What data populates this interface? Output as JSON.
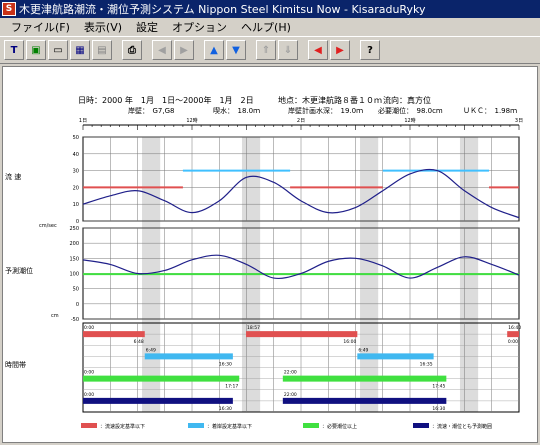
{
  "window": {
    "icon_text": "S",
    "title": "木更津航路潮流・潮位予測システム Nippon Steel Kimitsu Now - KisaraduRyky"
  },
  "menu": [
    "ファイル(F)",
    "表示(V)",
    "設定",
    "オプション",
    "ヘルプ(H)"
  ],
  "toolbar": {
    "buttons": [
      {
        "name": "t-button",
        "glyph": "T",
        "color": "#000080"
      },
      {
        "name": "window-button",
        "glyph": "▣",
        "color": "#008000"
      },
      {
        "name": "page-button",
        "glyph": "▭",
        "color": "#000"
      },
      {
        "name": "grid-button",
        "glyph": "▦",
        "color": "#000080"
      },
      {
        "name": "copy-button",
        "glyph": "▤",
        "color": "#808080"
      },
      {
        "name": "print-button",
        "glyph": "⎙",
        "color": "#000"
      },
      {
        "name": "prev-gray-button",
        "glyph": "◀",
        "color": "#a0a0a0"
      },
      {
        "name": "next-gray-button",
        "glyph": "▶",
        "color": "#a0a0a0"
      },
      {
        "name": "up-blue-button",
        "glyph": "▲",
        "color": "#1060e0"
      },
      {
        "name": "down-blue-button",
        "glyph": "▼",
        "color": "#1060e0"
      },
      {
        "name": "up-gray-button",
        "glyph": "⇑",
        "color": "#a0a0a0"
      },
      {
        "name": "down-gray-button",
        "glyph": "⇓",
        "color": "#a0a0a0"
      },
      {
        "name": "prev-red-button",
        "glyph": "◀",
        "color": "#e02020"
      },
      {
        "name": "next-red-button",
        "glyph": "▶",
        "color": "#e02020"
      },
      {
        "name": "help-button",
        "glyph": "?",
        "color": "#000"
      }
    ]
  },
  "header": {
    "line1_date": "日時：2000 年　1月　1日～2000年　1月　2日",
    "line1_place": "地点：木更津航路８番１０ｍ",
    "line1_dir": "流向：真方位",
    "line2_pier": "岸壁：　G7,G8",
    "line2_draft": "喫水：　18.0ｍ",
    "line2_depth": "岸壁計画水深：　19.0ｍ",
    "line2_req": "必要潮位：　98.0cm",
    "line2_ukc": "ＵＫＣ：　1.98ｍ"
  },
  "axis": {
    "day_labels": [
      "1日",
      "12時",
      "2日",
      "12時",
      "3日"
    ],
    "flow_label": "流 速",
    "flow_unit": "cm/sec",
    "flow_ticks": [
      "50",
      "40",
      "30",
      "20",
      "10",
      "0"
    ],
    "tide_label": "予測潮位",
    "tide_unit": "cm",
    "tide_ticks": [
      "250",
      "200",
      "150",
      "100",
      "50",
      "0",
      "-50"
    ],
    "window_label": "時間帯"
  },
  "chart_data": {
    "type": "line",
    "x_range_hours": [
      0,
      48
    ],
    "series": [
      {
        "name": "流速",
        "color": "#20208a",
        "x": [
          0,
          3,
          6,
          9,
          12,
          15,
          18,
          21,
          24,
          27,
          30,
          33,
          36,
          39,
          42,
          45,
          48
        ],
        "values": [
          10,
          15,
          18,
          12,
          5,
          12,
          26,
          23,
          12,
          5,
          8,
          18,
          28,
          30,
          18,
          8,
          2
        ]
      },
      {
        "name": "潮位",
        "color": "#20208a",
        "x": [
          0,
          3,
          6,
          9,
          12,
          15,
          18,
          21,
          24,
          27,
          30,
          33,
          36,
          39,
          42,
          45,
          48
        ],
        "values": [
          145,
          130,
          100,
          110,
          145,
          160,
          130,
          85,
          100,
          140,
          150,
          125,
          85,
          120,
          155,
          130,
          95
        ]
      }
    ],
    "flow_ylim": [
      0,
      50
    ],
    "tide_ylim": [
      -50,
      250
    ],
    "flow_thresholds": [
      {
        "color": "#e05050",
        "value": 20,
        "ranges": [
          [
            0,
            11
          ],
          [
            22.8,
            33
          ],
          [
            44.7,
            48
          ]
        ]
      },
      {
        "color": "#40c0ff",
        "value": 30,
        "ranges": [
          [
            11,
            22.8
          ],
          [
            33,
            44.7
          ]
        ]
      }
    ],
    "tide_threshold": {
      "color": "#40e040",
      "value": 98
    },
    "shaded_night_hours": [
      [
        6.5,
        8.5
      ],
      [
        17.5,
        19.5
      ],
      [
        30.5,
        32.5
      ],
      [
        41.5,
        43.5
      ]
    ],
    "windows": [
      {
        "color": "#e05050",
        "bars": [
          [
            0,
            6.8
          ],
          [
            17.95,
            30.2
          ],
          [
            46.7,
            48
          ]
        ],
        "start_labels": [
          "0:00",
          "18:57",
          "16:40"
        ],
        "end_labels": [
          "6:48",
          "16:00",
          "0:00"
        ]
      },
      {
        "color": "#40b8f0",
        "bars": [
          [
            6.8,
            16.5
          ],
          [
            30.2,
            38.6
          ]
        ],
        "start_labels": [
          "6:49",
          "6:49"
        ],
        "end_labels": [
          "16:30",
          "16:35"
        ]
      },
      {
        "color": "#40e040",
        "bars": [
          [
            0,
            17.2
          ],
          [
            22,
            40
          ]
        ],
        "start_labels": [
          "0:00",
          "22:00"
        ],
        "end_labels": [
          "17:17",
          "17:45"
        ]
      },
      {
        "color": "#101080",
        "bars": [
          [
            0,
            16.5
          ],
          [
            22,
            40
          ]
        ],
        "start_labels": [
          "0:00",
          "22:00"
        ],
        "end_labels": [
          "16:30",
          "16:30"
        ]
      }
    ]
  },
  "legend": [
    {
      "color": "#e05050",
      "label": "：流速設定基準以下"
    },
    {
      "color": "#40b8f0",
      "label": "：着岸設定基準以下"
    },
    {
      "color": "#40e040",
      "label": "：必要潮位以上"
    },
    {
      "color": "#101080",
      "label": "：流速・潮位とも予測範囲"
    }
  ]
}
